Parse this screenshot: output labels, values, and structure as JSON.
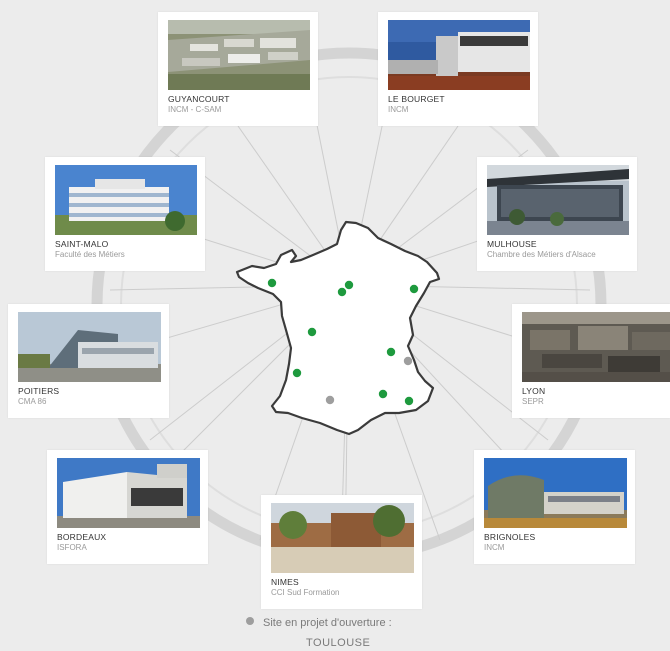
{
  "sites": [
    {
      "city": "GUYANCOURT",
      "org": "INCM - C-SAM"
    },
    {
      "city": "LE BOURGET",
      "org": "INCM"
    },
    {
      "city": "SAINT-MALO",
      "org": "Faculté des Métiers"
    },
    {
      "city": "MULHOUSE",
      "org": "Chambre des Métiers d'Alsace"
    },
    {
      "city": "POITIERS",
      "org": "CMA 86"
    },
    {
      "city": "LYON",
      "org": "SEPR"
    },
    {
      "city": "BORDEAUX",
      "org": "ISFORA"
    },
    {
      "city": "BRIGNOLES",
      "org": "INCM"
    },
    {
      "city": "NIMES",
      "org": "CCI Sud Formation"
    }
  ],
  "legend": {
    "label": "Site en projet d'ouverture :",
    "city": "TOULOUSE"
  },
  "colors": {
    "active_site": "#1e9a3e",
    "planned_site": "#9e9e9e",
    "ring": "#d4d4d4",
    "map_outline": "#3b3b3b",
    "background": "#ececec"
  }
}
